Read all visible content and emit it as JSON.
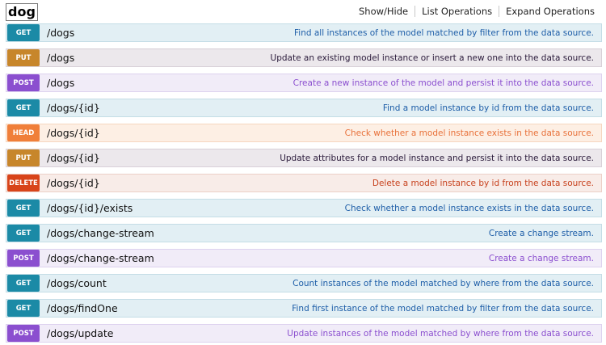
{
  "resource": {
    "name": "dog"
  },
  "header_links": [
    "Show/Hide",
    "List Operations",
    "Expand Operations"
  ],
  "operations": [
    {
      "method": "GET",
      "path": "/dogs",
      "summary": "Find all instances of the model matched by filter from the data source."
    },
    {
      "method": "PUT",
      "path": "/dogs",
      "summary": "Update an existing model instance or insert a new one into the data source."
    },
    {
      "method": "POST",
      "path": "/dogs",
      "summary": "Create a new instance of the model and persist it into the data source."
    },
    {
      "method": "GET",
      "path": "/dogs/{id}",
      "summary": "Find a model instance by id from the data source."
    },
    {
      "method": "HEAD",
      "path": "/dogs/{id}",
      "summary": "Check whether a model instance exists in the data source."
    },
    {
      "method": "PUT",
      "path": "/dogs/{id}",
      "summary": "Update attributes for a model instance and persist it into the data source."
    },
    {
      "method": "DELETE",
      "path": "/dogs/{id}",
      "summary": "Delete a model instance by id from the data source."
    },
    {
      "method": "GET",
      "path": "/dogs/{id}/exists",
      "summary": "Check whether a model instance exists in the data source."
    },
    {
      "method": "GET",
      "path": "/dogs/change-stream",
      "summary": "Create a change stream."
    },
    {
      "method": "POST",
      "path": "/dogs/change-stream",
      "summary": "Create a change stream."
    },
    {
      "method": "GET",
      "path": "/dogs/count",
      "summary": "Count instances of the model matched by where from the data source."
    },
    {
      "method": "GET",
      "path": "/dogs/findOne",
      "summary": "Find first instance of the model matched by filter from the data source."
    },
    {
      "method": "POST",
      "path": "/dogs/update",
      "summary": "Update instances of the model matched by where from the data source."
    }
  ]
}
